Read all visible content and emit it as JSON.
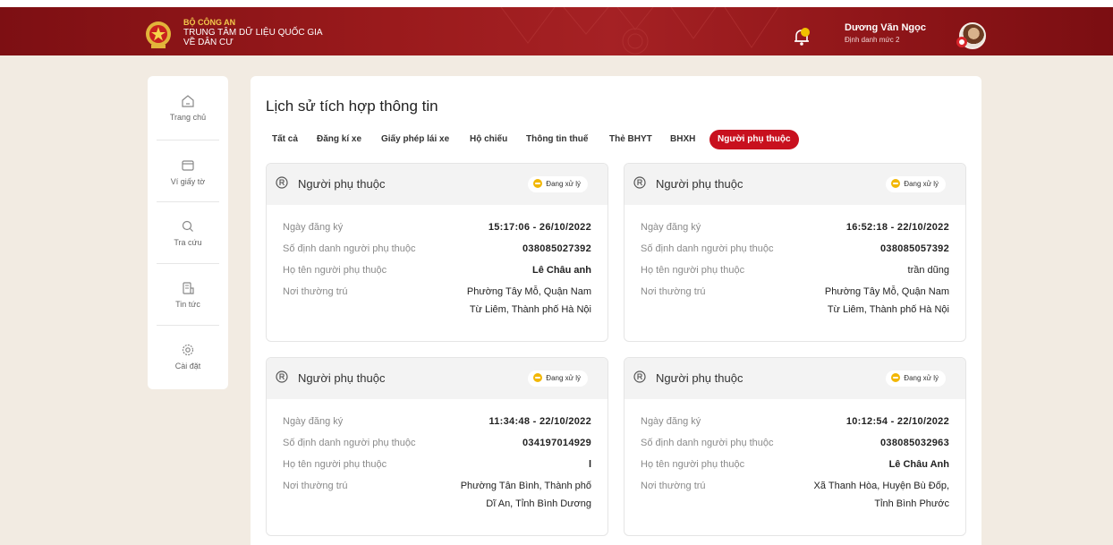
{
  "header": {
    "org_line1": "BỘ CÔNG AN",
    "org_line2": "TRUNG TÂM DỮ LIỆU QUỐC GIA",
    "org_line3": "VỀ DÂN CƯ",
    "user_name": "Dương Văn Ngọc",
    "user_level": "Định danh mức 2",
    "brand_color": "#9a1a1c",
    "accent_color": "#f3c94c"
  },
  "sidebar": {
    "items": [
      {
        "label": "Trang chủ",
        "icon": "home-icon"
      },
      {
        "label": "Ví giấy tờ",
        "icon": "wallet-icon"
      },
      {
        "label": "Tra cứu",
        "icon": "search-icon"
      },
      {
        "label": "Tin tức",
        "icon": "news-icon"
      },
      {
        "label": "Cài đặt",
        "icon": "gear-icon"
      }
    ]
  },
  "main": {
    "title": "Lịch sử tích hợp thông tin",
    "tabs": [
      {
        "label": "Tất cả"
      },
      {
        "label": "Đăng kí xe"
      },
      {
        "label": "Giấy phép lái xe"
      },
      {
        "label": "Hộ chiếu"
      },
      {
        "label": "Thông tin thuế"
      },
      {
        "label": "Thẻ BHYT"
      },
      {
        "label": "BHXH"
      },
      {
        "label": "Người phụ thuộc",
        "active": true
      }
    ],
    "active_tab_color": "#c8101e",
    "field_labels": {
      "date": "Ngày đăng ký",
      "id": "Số định danh người phụ thuộc",
      "name": "Họ tên người phụ thuộc",
      "address": "Nơi thường trú"
    },
    "cards": [
      {
        "title": "Người phụ thuộc",
        "status": "Đang xử lý",
        "date": "15:17:06 - 26/10/2022",
        "id": "038085027392",
        "name": "Lê Châu anh",
        "address_line1": "Phường Tây Mỗ, Quận Nam",
        "address_line2": "Từ Liêm, Thành phố Hà Nội"
      },
      {
        "title": "Người phụ thuộc",
        "status": "Đang xử lý",
        "date": "16:52:18 - 22/10/2022",
        "id": "038085057392",
        "name": "trần dũng",
        "address_line1": "Phường Tây Mỗ, Quận Nam",
        "address_line2": "Từ Liêm, Thành phố Hà Nội"
      },
      {
        "title": "Người phụ thuộc",
        "status": "Đang xử lý",
        "date": "11:34:48 - 22/10/2022",
        "id": "034197014929",
        "name": "l",
        "address_line1": "Phường Tân Bình, Thành phố",
        "address_line2": "Dĩ An, Tỉnh Bình Dương"
      },
      {
        "title": "Người phụ thuộc",
        "status": "Đang xử lý",
        "date": "10:12:54 - 22/10/2022",
        "id": "038085032963",
        "name": "Lê Châu Anh",
        "address_line1": "Xã Thanh Hòa, Huyện Bù Đốp,",
        "address_line2": "Tỉnh Bình Phước"
      }
    ],
    "status_color": "#f2b705"
  }
}
